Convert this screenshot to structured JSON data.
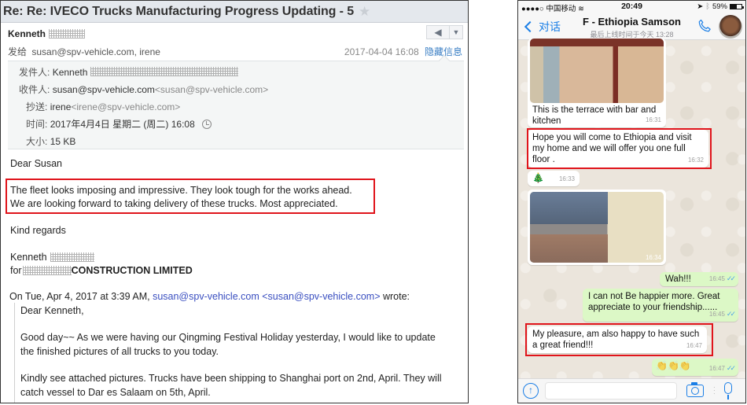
{
  "email": {
    "subject": "Re: Re: IVECO Trucks Manufacturing Progress Updating - 5",
    "sender_name": "Kenneth",
    "to_label": "发给",
    "to_value": "susan@spv-vehicle.com, irene",
    "date": "2017-04-04 16:08",
    "hide_details_link": "隐藏信息",
    "details": {
      "from_label": "发件人:",
      "from_value": "Kenneth",
      "to_label": "收件人:",
      "to_name": "susan@spv-vehicle.com",
      "to_addr": "<susan@spv-vehicle.com>",
      "cc_label": "抄送:",
      "cc_name": "irene",
      "cc_addr": "<irene@spv-vehicle.com>",
      "time_label": "时间:",
      "time_value": "2017年4月4日 星期二 (周二) 16:08",
      "size_label": "大小:",
      "size_value": "15 KB"
    },
    "body": {
      "greeting": "Dear Susan",
      "highlight_line1": "The fleet looks imposing and impressive. They look tough for the works ahead.",
      "highlight_line2": "We are looking forward to taking delivery of these trucks. Most appreciated.",
      "closing": "Kind regards",
      "sig_name": "Kenneth",
      "sig_for": "for",
      "sig_company": "CONSTRUCTION LIMITED"
    },
    "quote": {
      "header_prefix": "On Tue, Apr 4, 2017 at 3:39 AM,",
      "header_link": "susan@spv-vehicle.com",
      "header_addr_link": "<susan@spv-vehicle.com>",
      "header_suffix": "wrote:",
      "greeting": "Dear Kenneth,",
      "para1_line1": "Good day~~ As we were having our Qingming Festival Holiday yesterday, I would like to update",
      "para1_line2": "the finished pictures of all trucks to you today.",
      "para2_line1": "Kindly see attached pictures. Trucks have been shipping to Shanghai port on 2nd, April. They will",
      "para2_line2": "catch vessel to Dar es Salaam on 5th, April."
    }
  },
  "whatsapp": {
    "status_bar": {
      "carrier": "●●●●○ 中国移动",
      "time": "20:49",
      "battery": "59%",
      "battery_level": 0.59
    },
    "nav": {
      "back_label": "对话",
      "contact_name": "F - Ethiopia Samson",
      "last_seen": "最后上线时间于今天 13:28"
    },
    "messages": [
      {
        "dir": "in",
        "type": "image",
        "caption_line1": "This is the terrace with bar and",
        "caption_line2": "kitchen",
        "time": "16:31"
      },
      {
        "dir": "in",
        "type": "text",
        "line1": "Hope you will come to Ethiopia and visit",
        "line2": "my home and we will offer you one full",
        "line3": "floor .",
        "time": "16:32"
      },
      {
        "dir": "in",
        "type": "emoji",
        "text": "🎄",
        "time": "16:33"
      },
      {
        "dir": "in",
        "type": "image",
        "time": "16:34"
      },
      {
        "dir": "out",
        "type": "text",
        "line1": "Wah!!!",
        "time": "16:45",
        "status": "read"
      },
      {
        "dir": "out",
        "type": "text",
        "line1": "I can not Be happier more. Great",
        "line2": "appreciate to your friendship......",
        "time": "16:45",
        "status": "read"
      },
      {
        "dir": "in",
        "type": "text",
        "line1": "My pleasure, am also happy to have such",
        "line2": "a great friend!!!",
        "time": "16:47"
      },
      {
        "dir": "out",
        "type": "emoji",
        "text": "👏👏👏",
        "time": "16:47",
        "status": "read"
      }
    ],
    "input_placeholder": ""
  },
  "colors": {
    "highlight_border": "#e0141b",
    "ios_blue": "#1a7ee6",
    "outgoing_bubble": "#dcf8c6",
    "link_blue": "#3a4fc0"
  }
}
